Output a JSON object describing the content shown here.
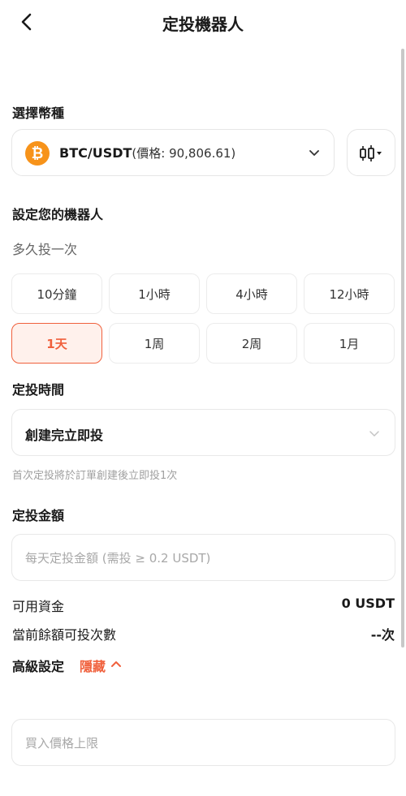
{
  "header": {
    "title": "定投機器人"
  },
  "coin_section": {
    "label": "選擇幣種",
    "coin_symbol": "₿",
    "pair": "BTC/USDT",
    "price_text": "(價格: 90,806.61)",
    "accent_color": "#f7931a"
  },
  "robot_section": {
    "label": "設定您的機器人",
    "frequency_label": "多久投一次",
    "frequency_options": [
      "10分鐘",
      "1小時",
      "4小時",
      "12小時",
      "1天",
      "1周",
      "2周",
      "1月"
    ],
    "selected_index": 4
  },
  "time_section": {
    "label": "定投時間",
    "selected_value": "創建完立即投",
    "hint": "首次定投將於訂單創建後立即投1次"
  },
  "amount_section": {
    "label": "定投金額",
    "placeholder": "每天定投金額 (需投 ≥ 0.2 USDT)"
  },
  "balance": {
    "available_label": "可用資金",
    "available_value": "0 USDT",
    "count_label": "當前餘額可投次數",
    "count_value": "--次"
  },
  "advanced": {
    "label": "高級設定",
    "toggle_text": "隱藏",
    "max_price_placeholder": "買入價格上限"
  },
  "theme": {
    "accent": "#f0603c"
  }
}
